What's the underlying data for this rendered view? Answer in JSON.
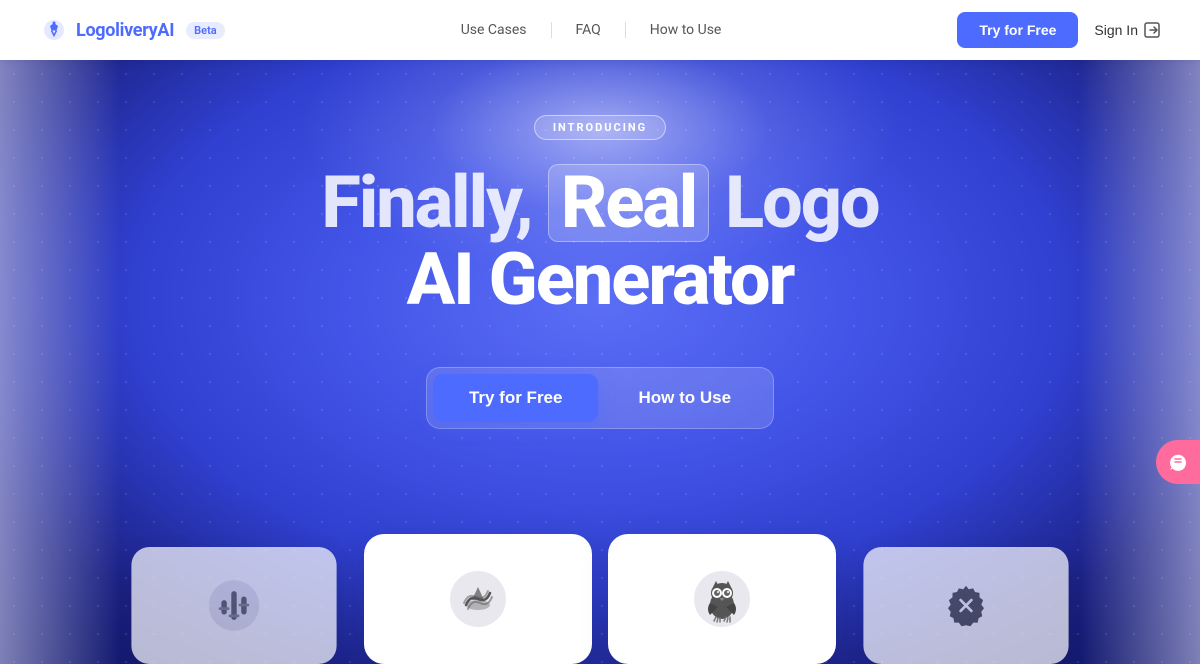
{
  "navbar": {
    "logo_text_main": "Logolivery",
    "logo_text_ai": "AI",
    "beta_label": "Beta",
    "nav_links": [
      {
        "id": "use-cases",
        "label": "Use Cases"
      },
      {
        "id": "faq",
        "label": "FAQ"
      },
      {
        "id": "how-to-use",
        "label": "How to Use"
      }
    ],
    "try_free_label": "Try for Free",
    "sign_in_label": "Sign In"
  },
  "hero": {
    "introducing_label": "INTRODUCING",
    "title_part1": "Finally, ",
    "title_highlight": "Real",
    "title_part2": " Logo",
    "title_line2": "AI Generator"
  },
  "cta": {
    "try_free_label": "Try for Free",
    "how_to_use_label": "How to Use"
  },
  "logo_cards": [
    {
      "id": "card-1",
      "icon": "sliders"
    },
    {
      "id": "card-2",
      "icon": "ship"
    },
    {
      "id": "card-3",
      "icon": "owl"
    },
    {
      "id": "card-4",
      "icon": "badge-x"
    }
  ],
  "chat": {
    "icon": "chat-icon"
  }
}
